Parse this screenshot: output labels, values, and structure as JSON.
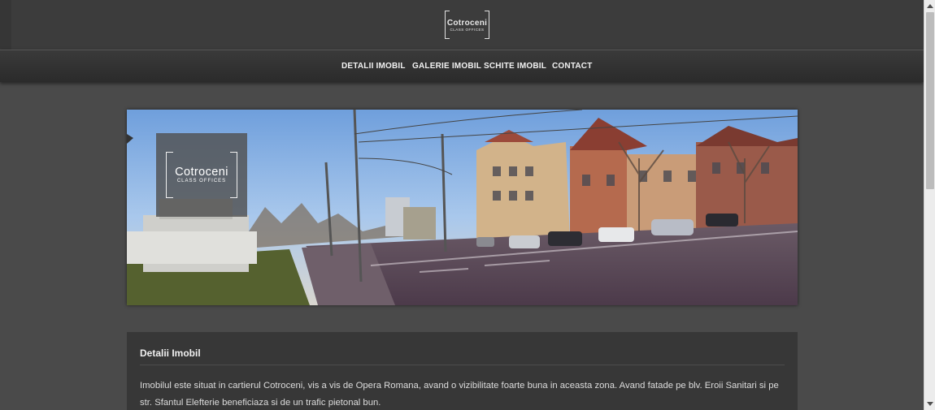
{
  "logo": {
    "name": "Cotroceni",
    "tagline": "CLASS OFFICES"
  },
  "nav": {
    "items": [
      {
        "label": "DETALII IMOBIL"
      },
      {
        "label": "GALERIE IMOBIL"
      },
      {
        "label": "SCHITE IMOBIL"
      },
      {
        "label": "CONTACT"
      }
    ]
  },
  "hero": {
    "logo_name": "Cotroceni",
    "logo_tagline": "CLASS OFFICES"
  },
  "details": {
    "title": "Detalii Imobil",
    "text": "Imobilul este situat in cartierul Cotroceni, vis a vis de Opera Romana, avand o vizibilitate foarte buna in aceasta zona. Avand fatade pe blv. Eroii Sanitari si pe str. Sfantul Elefterie beneficiaza si de un trafic pietonal bun."
  },
  "colors": {
    "page_bg": "#4a4a4a",
    "header_bg": "#3c3c3c",
    "panel_bg": "#373737",
    "text": "#dcdcdc"
  }
}
